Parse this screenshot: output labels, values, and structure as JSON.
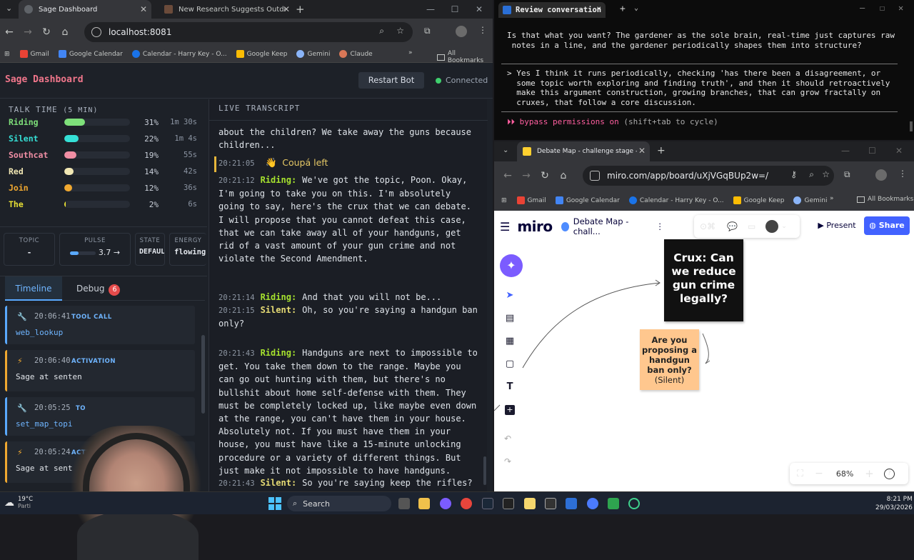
{
  "left_browser": {
    "tabs": [
      {
        "title": "Sage Dashboard",
        "active": true
      },
      {
        "title": "New Research Suggests Outdoor Cat...",
        "active": false
      }
    ],
    "url": "localhost:8081",
    "bookmarks": [
      "Gmail",
      "Google Calendar",
      "Calendar - Harry Key - O...",
      "Google Keep",
      "Gemini",
      "Claude"
    ],
    "all_bookmarks": "All Bookmarks"
  },
  "dashboard": {
    "title": "Sage Dashboard",
    "restart_label": "Restart Bot",
    "status": "Connected",
    "talk_time_title": "TALK TIME",
    "talk_time_window": "(5 MIN)",
    "speakers": [
      {
        "name": "Riding",
        "pct": "31%",
        "time": "1m 30s",
        "fraction": 0.31,
        "color": "#7ee07a"
      },
      {
        "name": "Silent",
        "pct": "22%",
        "time": "1m 4s",
        "fraction": 0.22,
        "color": "#35e0d6"
      },
      {
        "name": "Southcat",
        "pct": "19%",
        "time": "55s",
        "fraction": 0.19,
        "color": "#f08ea4"
      },
      {
        "name": "Red",
        "pct": "14%",
        "time": "42s",
        "fraction": 0.14,
        "color": "#f1e7b4"
      },
      {
        "name": "Join",
        "pct": "12%",
        "time": "36s",
        "fraction": 0.12,
        "color": "#f0a830"
      },
      {
        "name": "The",
        "pct": "2%",
        "time": "6s",
        "fraction": 0.02,
        "color": "#e8e035"
      }
    ],
    "cards": {
      "topic_label": "TOPIC",
      "topic_value": "-",
      "pulse_label": "PULSE",
      "pulse_value": "3.7 →",
      "state_label": "STATE",
      "state_value": "DEFAULT",
      "energy_label": "ENERGY",
      "energy_value": "flowing"
    },
    "tabs": {
      "timeline": "Timeline",
      "debug": "Debug",
      "debug_count": "6"
    },
    "events": [
      {
        "time": "20:06:41",
        "kind": "TOOL CALL",
        "name": "web_lookup"
      },
      {
        "time": "20:06:40",
        "kind": "ACTIVATION",
        "name": "Sage at senten"
      },
      {
        "time": "20:05:25",
        "kind": "TO",
        "name": "set_map_topi"
      },
      {
        "time": "20:05:24",
        "kind": "ACTIVAT",
        "name": "Sage at sent"
      }
    ],
    "transcript_title": "LIVE TRANSCRIPT",
    "transcript_top": "about the children? We take away the guns because children...",
    "left_event": {
      "time": "20:21:05",
      "text": "Coupá left"
    },
    "transcript": [
      {
        "time": "20:21:12",
        "speaker": "Riding",
        "text": "We've got the topic, Poon. Okay, I'm going to take you on this. I'm absolutely going to say, here's the crux that we can debate. I will propose that you cannot defeat this case, that we can take away all of your handguns, get rid of a vast amount of your gun crime and not violate the Second Amendment."
      },
      {
        "time": "20:21:14",
        "speaker": "Riding",
        "text": "And that you will not be..."
      },
      {
        "time": "20:21:15",
        "speaker": "Silent",
        "text": "Oh, so you're saying a handgun ban only?"
      },
      {
        "time": "20:21:43",
        "speaker": "Riding",
        "text": "Handguns are next to impossible to get. You take them down to the range. Maybe you can go out hunting with them, but there's no bullshit about home self-defense with them. They must be completely locked up, like maybe even down at the range, you can't have them in your house. Absolutely not. If you must have them in your house, you must have like a 15-minute unlocking procedure or a variety of different things. But just make it not impossible to have handguns."
      },
      {
        "time": "20:21:43",
        "speaker": "Silent",
        "text": "So you're saying keep the rifles?"
      }
    ]
  },
  "terminal": {
    "tab_title": "Review conversation",
    "lines1": [
      "Is that what you want? The gardener as the sole brain, real-time just captures raw",
      " notes in a line, and the gardener periodically shapes them into structure?"
    ],
    "lines2": [
      "> Yes I think it runs periodically, checking 'has there been a disagreement, or",
      "  some topic worth exploring and finding truth', and then it should retroactively",
      "  make this argument construction, growing branches, that can grow fractally on",
      "  cruxes, that follow a core discussion."
    ],
    "mode": "⏵⏵ bypass permissions on",
    "mode_hint": "(shift+tab to cycle)"
  },
  "miro_browser": {
    "tab_title": "Debate Map - challenge stage - Miro",
    "url": "miro.com/app/board/uXjVGqBUp2w=/",
    "bookmarks": [
      "Gmail",
      "Google Calendar",
      "Calendar - Harry Key - O...",
      "Google Keep",
      "Gemini"
    ],
    "all_bookmarks": "All Bookmarks",
    "logo": "miro",
    "board_name": "Debate Map - chall...",
    "present_label": "Present",
    "share_label": "Share",
    "zoom": "68%",
    "crux_note": "Crux: Can we reduce gun crime legally?",
    "question_note": "Are you proposing a handgun ban only?",
    "question_speaker": "(Silent)"
  },
  "taskbar": {
    "weather_temp": "19°C",
    "weather_loc": "Parti",
    "search_label": "Search",
    "time": "8:21 PM",
    "date": "29/03/2026"
  }
}
